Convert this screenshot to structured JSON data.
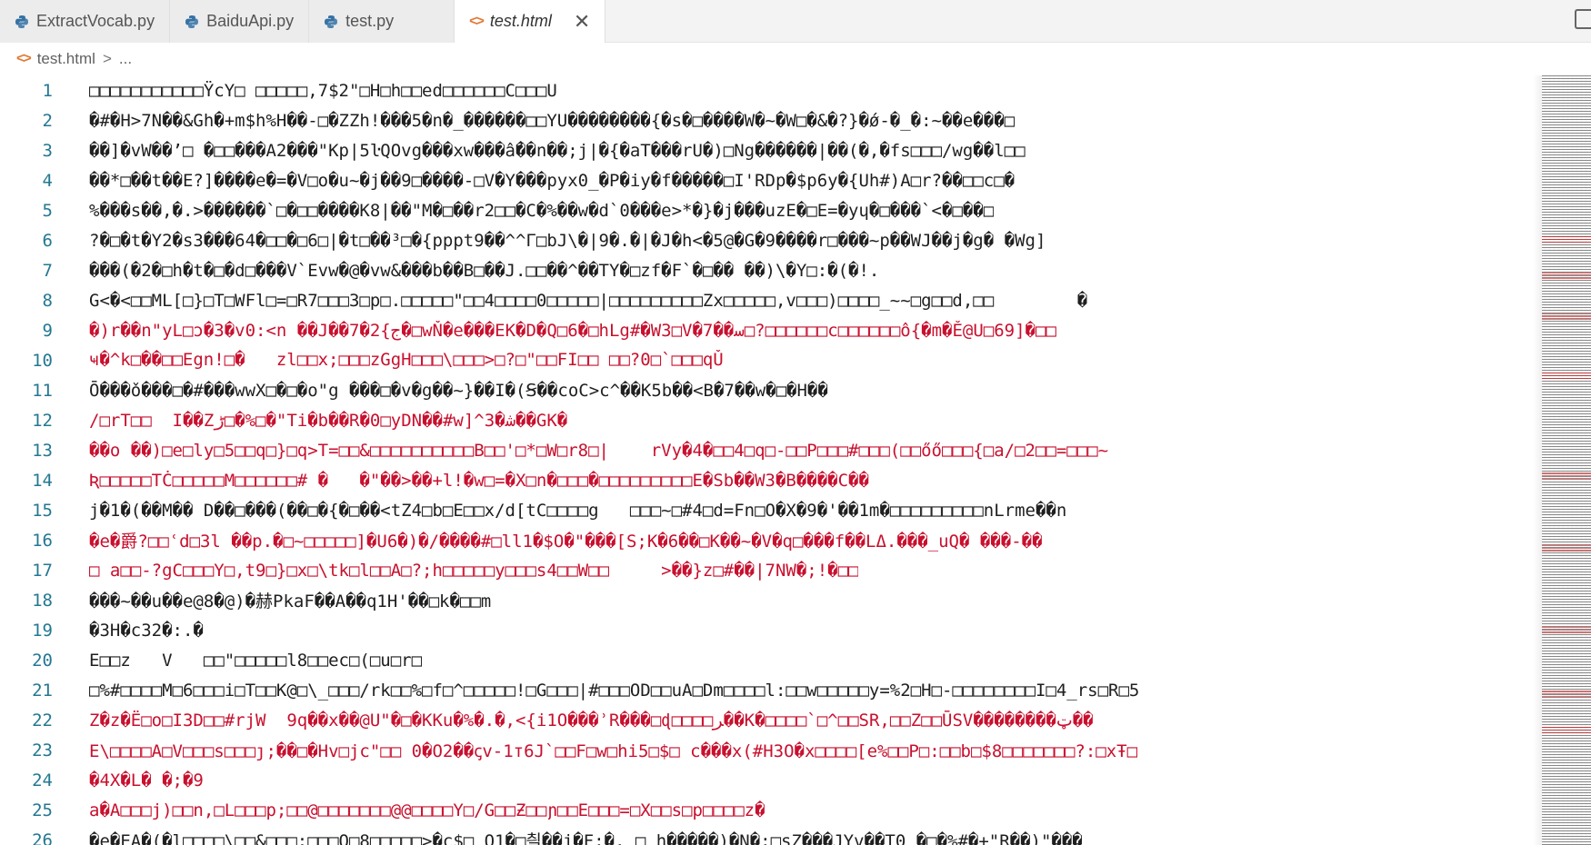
{
  "tabs": [
    {
      "label": "ExtractVocab.py",
      "icon": "python-icon",
      "active": false
    },
    {
      "label": "BaiduApi.py",
      "icon": "python-icon",
      "active": false
    },
    {
      "label": "test.py",
      "icon": "python-icon",
      "active": false
    },
    {
      "label": "test.html",
      "icon": "html-icon",
      "active": true
    }
  ],
  "tab_close_glyph": "✕",
  "breadcrumb": {
    "file": "test.html",
    "separator": ">",
    "rest": "..."
  },
  "colors": {
    "line_number": "#237893",
    "error_text": "#c8102e",
    "html_icon": "#e37933",
    "python_icon_blue": "#3572A5"
  },
  "editor": {
    "lines": [
      {
        "n": "1",
        "text": "□□□□□□□□□□□ŸcY□ □□□□□,7$2\"□H□h□□ed□□□□□□C□□□U",
        "err": false
      },
      {
        "n": "2",
        "text": "�#�H>7N��&Gh�+m$h%H��-□�ZZh!���5�n�_������□□YU��������{�s�□����W�~�W□�&�?}�ǿ-�_�:~��e���□",
        "err": false
      },
      {
        "n": "3",
        "text": "��]�vW��’□ �□□���A2���\"Kp|5ŀQOvg���xw���ấ��n��;j|�{�aT���rU�)□Ng������|��(�,�fs□□□/wg��l□□",
        "err": false
      },
      {
        "n": "4",
        "text": "��*□��t��E?]����e�=�V□o�u~�j��9□����-□V�Y���pyx0_�P�iy�f�����□I'RDp�$p6y�{Uh#)A□r?��□□c□�",
        "err": false
      },
      {
        "n": "5",
        "text": "%���s��,�.>������`□�□□����K8|��\"M�□��r2□□�C�%��w�d`0���e>*�}�j���uzE�□E=�yɥ�□���`<�□��□",
        "err": false
      },
      {
        "n": "6",
        "text": "?�□�t�Y2�s3���64�□□�□6□|�t□��³□�{pppt9��^^Γ□bJ\\�|9�.�|�J�h<�5@�G�9����r□���~p��WJ��j�g� �Wg]",
        "err": false
      },
      {
        "n": "7",
        "text": "���(�2�□h�t�□�d□���V`Evw�@�vw&���b��B□��J.□□��^��TY�□zf�F`�□�� ��)\\�Y□:�(�!.",
        "err": false
      },
      {
        "n": "8",
        "text": "G<�<□□ML[□}□T□WFl□=□R7□□□3□p□.□□□□□\"□□4□□□□0□□□□□|□□□□□□□□□Zx□□□□□,v□□□)□□□□_~~□g□□d,□□        �",
        "err": false
      },
      {
        "n": "9",
        "text": "�)r��n\"yL□ɔ�3�v0:<n ��J��7�2{ج�□wŇ�e���EK�D�Q□6�□hLg#�W3□V�7��ﺳ□?□□□□□□c□□□□□□ô{�m�Ě@U□69]�□□",
        "err": true
      },
      {
        "n": "10",
        "text": "ҹ�^k□��□□Egn!□�   zl□□x;□□□zGgH□□□\\□□□>□?□\"□□FI□□ □□?0□`□□□qǓ",
        "err": true
      },
      {
        "n": "11",
        "text": "Ō���ǒ���□�#���wwX□�□�o\"g ���□�v�g��~}��I�(Ꞩ��coC>c^��K5b��<B�7��w�□�H��",
        "err": false
      },
      {
        "n": "12",
        "text": "/□rT□□  I��Zڑ□�%□�\"Ti�b��R�0□yDN��#w]^3�ﺷ��GK�",
        "err": true
      },
      {
        "n": "13",
        "text": "��o ��)□e□ly□5□□q□}□q>T=□□&□□□□□□□□□□B□□'□*□W□r8□|    rVy�4�□□4□q□-□□P□□□#□□□(□□őő□□□{□a/□2□□=□□□~",
        "err": true
      },
      {
        "n": "14",
        "text": "Ʀ□□□□□TĊ□□□□□M□□□□□□# �   �\"��>��+l!�w□=�X□n�□□□�□□□□□□□□□E�Sb��W3�B����C��",
        "err": true
      },
      {
        "n": "15",
        "text": "j�1�(��M�� D��□���(��□�{�□��<tZ4□b□E□□x/d[tC□□□□g   □□□~□#4□d=Fn□O�X�9�'��1m�□□□□□□□□□nLrme��n",
        "err": false
      },
      {
        "n": "16",
        "text": "�e�爵?□□ʿd□3l ��p.�□~□□□□□]�U6�)�/����#□ll1�$O�\"���[S;K�6��□K��~�V�q□���f��LΔ.���_uQ� ���-��",
        "err": true
      },
      {
        "n": "17",
        "text": "□ a□□-?gC□□□Y□,t9□}□x□\\tk□l□□A□?;h□□□□□y□□□s4□□W□□     >��}z□#��|7NW�;!�□□",
        "err": true
      },
      {
        "n": "18",
        "text": "���~��u��e@8�@)�赫PkaF��A��q1H'��□k�□□m",
        "err": false
      },
      {
        "n": "19",
        "text": "�3H�c32�:.�",
        "err": false
      },
      {
        "n": "20",
        "text": "E□□z   V   □□\"□□□□□l8□□ec□(□u□r□",
        "err": false
      },
      {
        "n": "21",
        "text": "□%#□□□□M□6□□□i□T□□K@□\\_□□□/rk□□%□f□^□□□□□!□G□□□|#□□□OD□□uA□Dm□□□□l:□□w□□□□□y=%2□H□-□□□□□□□□I□4_rs□R□5",
        "err": false
      },
      {
        "n": "22",
        "text": "Z�z�Ë□o□I3D□□#rjW  9q��x��@U\"�□�KKu�%�.�,<{i1O���ʾR���□ɖ□□□□ﺮ��K�□□□□`□^□□SR,□□Z□□ŪSV��������ټ��",
        "err": true
      },
      {
        "n": "23",
        "text": "E\\□□□□A□V□□□s□□□ȷ;��□�Hv□jc\"□□ 0�O2��ꞔv-1т6J`□□F□w□hi5□$□ c���x(#H3O�x□□□□[e%□□P□:□□b□$8□□□□□□□?:□xŦ□",
        "err": true
      },
      {
        "n": "24",
        "text": "�4X�L� �;�9",
        "err": true
      },
      {
        "n": "25",
        "text": "a�A□□□j)□□n,□L□□□p;□□@□□□□□□□@@□□□□Y□/G□□Ƶ□□ɲ□□E□□□=□X□□s□p□□□□z�",
        "err": true
      },
      {
        "n": "26",
        "text": "�e�EA�(�l□□□□\\□□&□□□:□□□O□8□□□□□>�c$□ O1�□칄��j�F:�. □ h�����)�N�:□sZ���JYv��T0 �□�%#�+\"R��)\"���",
        "err": false
      }
    ]
  }
}
